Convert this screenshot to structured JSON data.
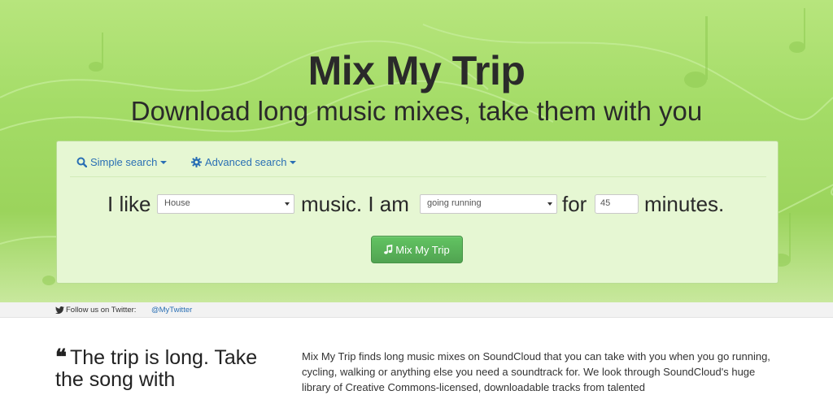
{
  "hero": {
    "title": "Mix My Trip",
    "subtitle": "Download long music mixes, take them with you"
  },
  "tabs": {
    "simple": "Simple search",
    "advanced": "Advanced search"
  },
  "sentence": {
    "i_like": "I like",
    "genre_value": "House",
    "music_i_am": "music. I am",
    "activity_value": "going running",
    "for": "for",
    "minutes_value": "45",
    "minutes": "minutes."
  },
  "button": {
    "label": "Mix My Trip"
  },
  "twitter": {
    "follow": "Follow us on Twitter:",
    "handle": "@MyTwitter"
  },
  "content": {
    "quote": "The trip is long. Take the song with",
    "about": "Mix My Trip finds long music mixes on SoundCloud that you can take with you when you go running, cycling, walking or anything else you need a soundtrack for. We look through SoundCloud's huge library of Creative Commons-licensed, downloadable tracks from talented"
  },
  "colors": {
    "accent": "#2a6fb4",
    "button": "#5bb75b",
    "hero": "#a4dc67"
  },
  "icons": {
    "simple_tab": "search-icon",
    "advanced_tab": "gear-icon",
    "button": "music-note-icon",
    "twitter": "twitter-bird-icon",
    "quote": "quote-icon"
  }
}
